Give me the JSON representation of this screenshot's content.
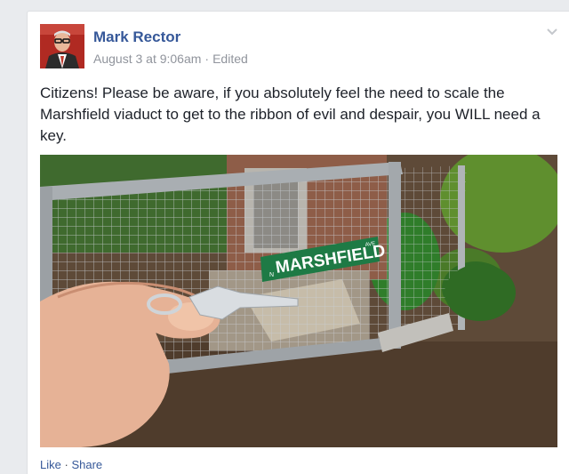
{
  "post": {
    "author": "Mark Rector",
    "date": "August 3 at 9:06am",
    "separator": "·",
    "edited": "Edited",
    "text": "Citizens! Please be aware, if you absolutely feel the need to scale the Marshfield viaduct to get to the ribbon of evil and despair, you WILL need a key.",
    "photo": {
      "sign_text": "MARSHFIELD",
      "sign_prefix": "N",
      "sign_suffix": "AVE",
      "sign_color": "#1e7a45"
    }
  },
  "actions": {
    "like": "Like",
    "separator": "·",
    "share": "Share"
  },
  "colors": {
    "link": "#365899",
    "meta": "#90949c",
    "text": "#1d2129",
    "background": "#e9ebee"
  },
  "icons": {
    "menu": "chevron-down-icon"
  }
}
